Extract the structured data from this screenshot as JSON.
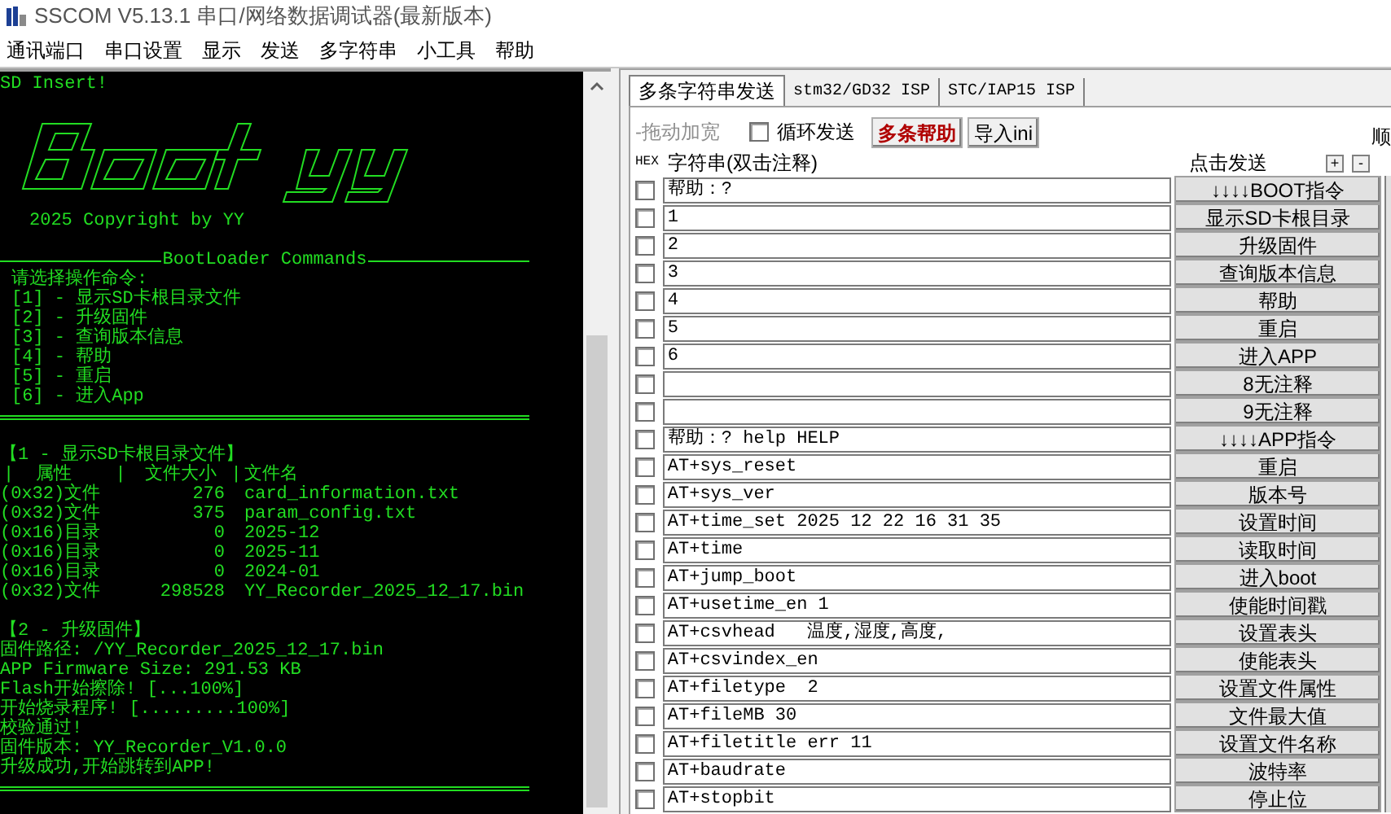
{
  "window": {
    "title": "SSCOM V5.13.1 串口/网络数据调试器(最新版本)"
  },
  "menu": [
    "通讯端口",
    "串口设置",
    "显示",
    "发送",
    "多字符串",
    "小工具",
    "帮助"
  ],
  "terminal": {
    "lines": [
      {
        "kind": "text",
        "text": "SD Insert!"
      },
      {
        "kind": "blank"
      },
      {
        "kind": "logo",
        "caption": "2025 Copyright by YY"
      },
      {
        "kind": "blank"
      },
      {
        "kind": "rule",
        "label": "BootLoader Commands"
      },
      {
        "kind": "indented",
        "text": "请选择操作命令:"
      },
      {
        "kind": "indented",
        "text": "[1] - 显示SD卡根目录文件"
      },
      {
        "kind": "indented",
        "text": "[2] - 升级固件"
      },
      {
        "kind": "indented",
        "text": "[3] - 查询版本信息"
      },
      {
        "kind": "indented",
        "text": "[4] - 帮助"
      },
      {
        "kind": "indented",
        "text": "[5] - 重启"
      },
      {
        "kind": "indented",
        "text": "[6] - 进入App"
      },
      {
        "kind": "rule"
      },
      {
        "kind": "blank"
      },
      {
        "kind": "text",
        "text": "【1 - 显示SD卡根目录文件】"
      },
      {
        "kind": "header",
        "cells": [
          "|",
          "属性",
          "|",
          "文件大小",
          "|",
          "文件名"
        ]
      },
      {
        "kind": "file",
        "attr": "(0x32)文件",
        "size": "276",
        "name": "card_information.txt"
      },
      {
        "kind": "file",
        "attr": "(0x32)文件",
        "size": "375",
        "name": "param_config.txt"
      },
      {
        "kind": "file",
        "attr": "(0x16)目录",
        "size": "0",
        "name": "2025-12"
      },
      {
        "kind": "file",
        "attr": "(0x16)目录",
        "size": "0",
        "name": "2025-11"
      },
      {
        "kind": "file",
        "attr": "(0x16)目录",
        "size": "0",
        "name": "2024-01"
      },
      {
        "kind": "file",
        "attr": "(0x32)文件",
        "size": "298528",
        "name": "YY_Recorder_2025_12_17.bin"
      },
      {
        "kind": "blank"
      },
      {
        "kind": "text",
        "text": "【2 - 升级固件】"
      },
      {
        "kind": "text",
        "text": "固件路径: /YY_Recorder_2025_12_17.bin"
      },
      {
        "kind": "text",
        "text": "APP Firmware Size: 291.53 KB"
      },
      {
        "kind": "text",
        "text": "Flash开始擦除! [...100%]"
      },
      {
        "kind": "text",
        "text": "开始烧录程序! [.........100%]"
      },
      {
        "kind": "text",
        "text": "校验通过!"
      },
      {
        "kind": "text",
        "text": "固件版本: YY_Recorder_V1.0.0"
      },
      {
        "kind": "text",
        "text": "升级成功,开始跳转到APP!"
      },
      {
        "kind": "rule"
      }
    ]
  },
  "tabs": [
    {
      "label": "多条字符串发送",
      "selected": true
    },
    {
      "label": "stm32/GD32 ISP",
      "selected": false
    },
    {
      "label": "STC/IAP15 ISP",
      "selected": false
    }
  ],
  "toolbar": {
    "drag_label": "-拖动加宽",
    "loop": {
      "label": "循环发送",
      "checked": false
    },
    "help_button": "多条帮助",
    "import_button": "导入ini",
    "order_label": "顺"
  },
  "header": {
    "hex": "HEX",
    "string": "字符串(双击注释)",
    "send": "点击发送",
    "add": "+",
    "remove": "-"
  },
  "rows": [
    {
      "checked": false,
      "text": "帮助：?",
      "button": "↓↓↓↓BOOT指令"
    },
    {
      "checked": false,
      "text": "1",
      "button": "显示SD卡根目录"
    },
    {
      "checked": false,
      "text": "2",
      "button": "升级固件"
    },
    {
      "checked": false,
      "text": "3",
      "button": "查询版本信息"
    },
    {
      "checked": false,
      "text": "4",
      "button": "帮助"
    },
    {
      "checked": false,
      "text": "5",
      "button": "重启"
    },
    {
      "checked": false,
      "text": "6",
      "button": "进入APP"
    },
    {
      "checked": false,
      "button": "8无注释"
    },
    {
      "checked": false,
      "button": "9无注释"
    },
    {
      "checked": false,
      "text": "帮助：? help HELP",
      "button": "↓↓↓↓APP指令"
    },
    {
      "checked": false,
      "text": "AT+sys_reset",
      "button": "重启"
    },
    {
      "checked": false,
      "text": "AT+sys_ver",
      "button": "版本号"
    },
    {
      "checked": false,
      "text": "AT+time_set 2025 12 22 16 31 35",
      "button": "设置时间"
    },
    {
      "checked": false,
      "text": "AT+time",
      "button": "读取时间"
    },
    {
      "checked": false,
      "text": "AT+jump_boot",
      "button": "进入boot"
    },
    {
      "checked": false,
      "text": "AT+usetime_en 1",
      "button": "使能时间戳"
    },
    {
      "checked": false,
      "text": "AT+csvhead   温度,湿度,高度,",
      "button": "设置表头"
    },
    {
      "checked": false,
      "text": "AT+csvindex_en",
      "button": "使能表头"
    },
    {
      "checked": false,
      "text": "AT+filetype  2",
      "button": "设置文件属性"
    },
    {
      "checked": false,
      "text": "AT+fileMB 30",
      "button": "文件最大值"
    },
    {
      "checked": false,
      "text": "AT+filetitle err 11",
      "button": "设置文件名称"
    },
    {
      "checked": false,
      "text": "AT+baudrate",
      "button": "波特率"
    },
    {
      "checked": false,
      "text": "AT+stopbit",
      "button": "停止位"
    }
  ]
}
